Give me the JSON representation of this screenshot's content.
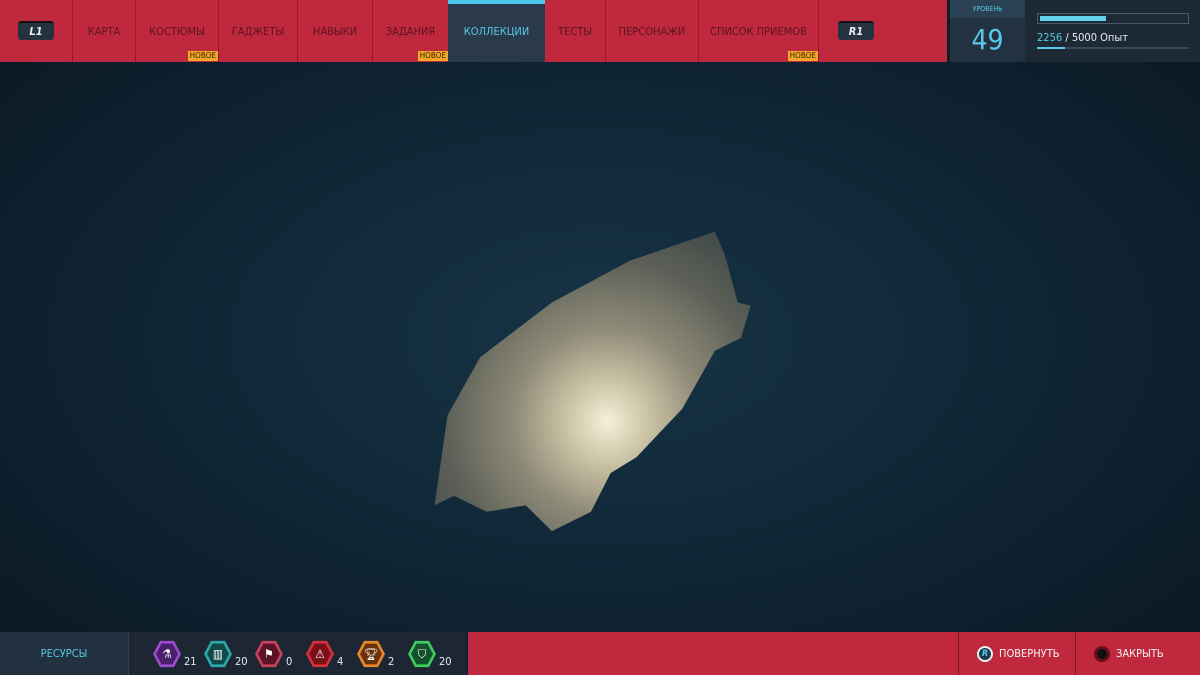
{
  "nav": {
    "left_button": "L1",
    "right_button": "R1",
    "tabs": [
      {
        "label": "КАРТА"
      },
      {
        "label": "КОСТЮМЫ",
        "badge": "НОВОЕ"
      },
      {
        "label": "ГАДЖЕТЫ"
      },
      {
        "label": "НАВЫКИ"
      },
      {
        "label": "ЗАДАНИЯ",
        "badge": "НОВОЕ"
      },
      {
        "label": "КОЛЛЕКЦИИ",
        "active": true
      },
      {
        "label": "ТЕСТЫ"
      },
      {
        "label": "ПЕРСОНАЖИ"
      },
      {
        "label": "СПИСОК ПРИЕМОВ",
        "badge": "НОВОЕ"
      }
    ]
  },
  "level": {
    "label": "УРОВЕНЬ",
    "value": "49"
  },
  "xp": {
    "current": "2256",
    "separator": " / ",
    "max": "5000 Опыт",
    "progress": 0.45
  },
  "resources": {
    "label": "РЕСУРСЫ",
    "items": [
      {
        "icon": "science-icon",
        "count": "21",
        "color": "#7a3aa0"
      },
      {
        "icon": "city-icon",
        "count": "20",
        "color": "#1f8a8a"
      },
      {
        "icon": "flag-icon",
        "count": "0",
        "color": "#a42a45"
      },
      {
        "icon": "warning-icon",
        "count": "4",
        "color": "#b0202e"
      },
      {
        "icon": "trophy-icon",
        "count": "2",
        "color": "#d06a1a"
      },
      {
        "icon": "backpack-icon",
        "count": "20",
        "color": "#2ea84a"
      }
    ]
  },
  "actions": {
    "rotate_key": "R",
    "rotate": "ПОВЕРНУТЬ",
    "close": "ЗАКРЫТЬ"
  }
}
